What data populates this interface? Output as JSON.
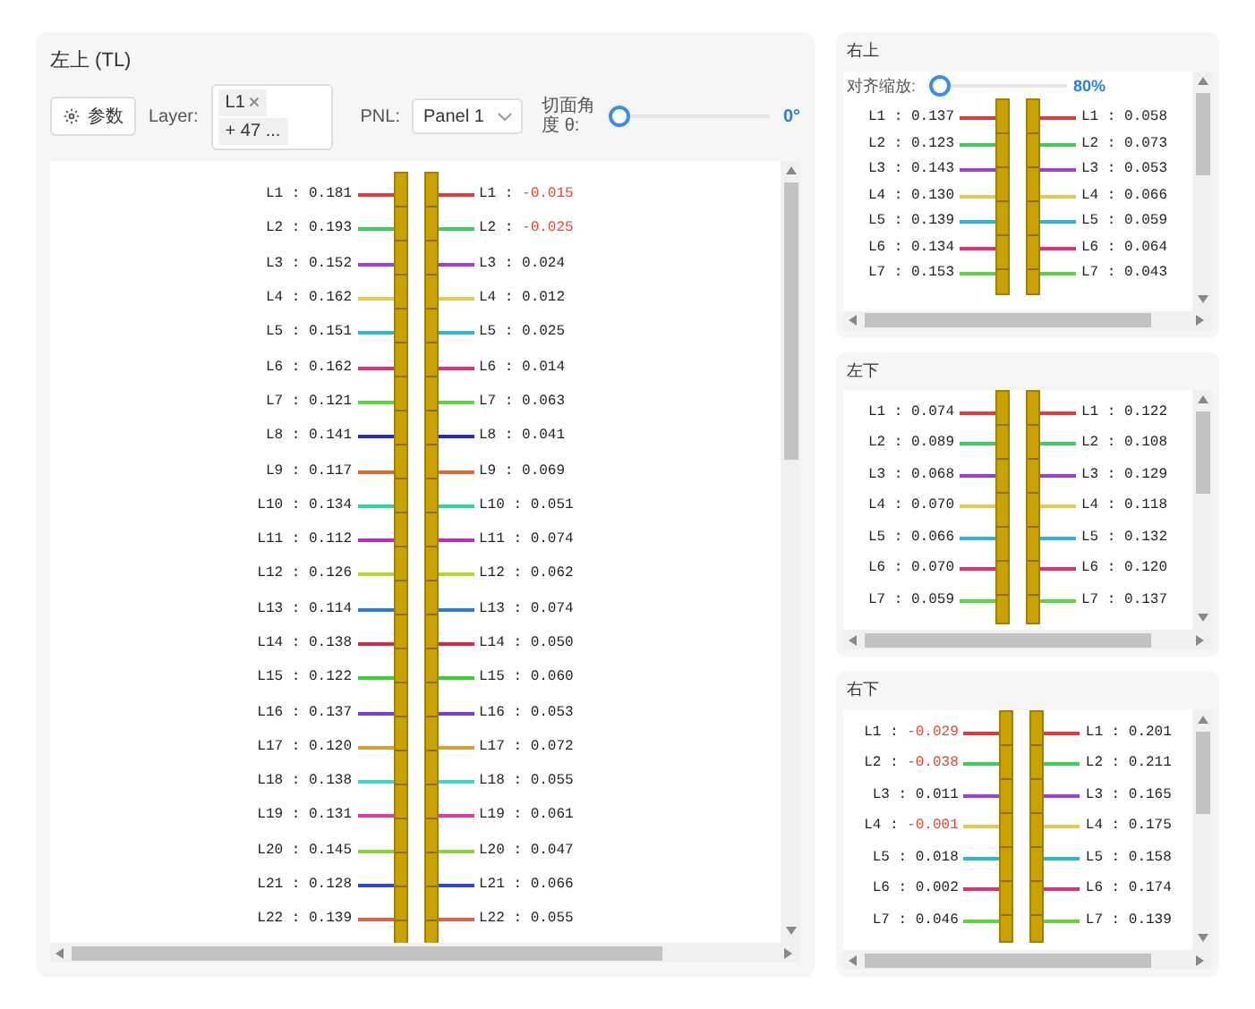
{
  "main": {
    "title": "左上 (TL)",
    "toolbar": {
      "params_button": "参数",
      "layer_label": "Layer:",
      "layer_tags": [
        "L1"
      ],
      "layer_more": "+ 47 ...",
      "pnl_label": "PNL:",
      "pnl_select": "Panel 1",
      "angle": {
        "label": "切面角度 θ:",
        "level": 0,
        "reading": "0°"
      }
    },
    "rows": [
      {
        "left_name": "L1 :",
        "left_value": "0.181",
        "left_alert": false,
        "right_name": "L1 :",
        "right_value": "-0.015",
        "right_alert": true,
        "color": "#e03c3c"
      },
      {
        "left_name": "L2 :",
        "left_value": "0.193",
        "left_alert": false,
        "right_name": "L2 :",
        "right_value": "-0.025",
        "right_alert": true,
        "color": "#3ccf5a"
      },
      {
        "left_name": "L3 :",
        "left_value": "0.152",
        "left_alert": false,
        "right_name": "L3 :",
        "right_value": "0.024",
        "right_alert": false,
        "color": "#9b3fd6"
      },
      {
        "left_name": "L4 :",
        "left_value": "0.162",
        "left_alert": false,
        "right_name": "L4 :",
        "right_value": "0.012",
        "right_alert": false,
        "color": "#e6c84a"
      },
      {
        "left_name": "L5 :",
        "left_value": "0.151",
        "left_alert": false,
        "right_name": "L5 :",
        "right_value": "0.025",
        "right_alert": false,
        "color": "#2bb5d8"
      },
      {
        "left_name": "L6 :",
        "left_value": "0.162",
        "left_alert": false,
        "right_name": "L6 :",
        "right_value": "0.014",
        "right_alert": false,
        "color": "#e0307a"
      },
      {
        "left_name": "L7 :",
        "left_value": "0.121",
        "left_alert": false,
        "right_name": "L7 :",
        "right_value": "0.063",
        "right_alert": false,
        "color": "#5bd63a"
      },
      {
        "left_name": "L8 :",
        "left_value": "0.141",
        "left_alert": false,
        "right_name": "L8 :",
        "right_value": "0.041",
        "right_alert": false,
        "color": "#2a2ab8"
      },
      {
        "left_name": "L9 :",
        "left_value": "0.117",
        "left_alert": false,
        "right_name": "L9 :",
        "right_value": "0.069",
        "right_alert": false,
        "color": "#e06a2a"
      },
      {
        "left_name": "L10 :",
        "left_value": "0.134",
        "left_alert": false,
        "right_name": "L10 :",
        "right_value": "0.051",
        "right_alert": false,
        "color": "#2ad69a"
      },
      {
        "left_name": "L11 :",
        "left_value": "0.112",
        "left_alert": false,
        "right_name": "L11 :",
        "right_value": "0.074",
        "right_alert": false,
        "color": "#c02ac8"
      },
      {
        "left_name": "L12 :",
        "left_value": "0.126",
        "left_alert": false,
        "right_name": "L12 :",
        "right_value": "0.062",
        "right_alert": false,
        "color": "#b8d62a"
      },
      {
        "left_name": "L13 :",
        "left_value": "0.114",
        "left_alert": false,
        "right_name": "L13 :",
        "right_value": "0.074",
        "right_alert": false,
        "color": "#2a7ad6"
      },
      {
        "left_name": "L14 :",
        "left_value": "0.138",
        "left_alert": false,
        "right_name": "L14 :",
        "right_value": "0.050",
        "right_alert": false,
        "color": "#d62a4a"
      },
      {
        "left_name": "L15 :",
        "left_value": "0.122",
        "left_alert": false,
        "right_name": "L15 :",
        "right_value": "0.060",
        "right_alert": false,
        "color": "#2ad62a"
      },
      {
        "left_name": "L16 :",
        "left_value": "0.137",
        "left_alert": false,
        "right_name": "L16 :",
        "right_value": "0.053",
        "right_alert": false,
        "color": "#7a3ad6"
      },
      {
        "left_name": "L17 :",
        "left_value": "0.120",
        "left_alert": false,
        "right_name": "L17 :",
        "right_value": "0.072",
        "right_alert": false,
        "color": "#e0a030"
      },
      {
        "left_name": "L18 :",
        "left_value": "0.138",
        "left_alert": false,
        "right_name": "L18 :",
        "right_value": "0.055",
        "right_alert": false,
        "color": "#3ad6d6"
      },
      {
        "left_name": "L19 :",
        "left_value": "0.131",
        "left_alert": false,
        "right_name": "L19 :",
        "right_value": "0.061",
        "right_alert": false,
        "color": "#e03ab0"
      },
      {
        "left_name": "L20 :",
        "left_value": "0.145",
        "left_alert": false,
        "right_name": "L20 :",
        "right_value": "0.047",
        "right_alert": false,
        "color": "#8ad63a"
      },
      {
        "left_name": "L21 :",
        "left_value": "0.128",
        "left_alert": false,
        "right_name": "L21 :",
        "right_value": "0.066",
        "right_alert": false,
        "color": "#2a4ad6"
      },
      {
        "left_name": "L22 :",
        "left_value": "0.139",
        "left_alert": false,
        "right_name": "L22 :",
        "right_value": "0.055",
        "right_alert": false,
        "color": "#e0604a"
      }
    ]
  },
  "side_panels": [
    {
      "title": "右上",
      "zoom": {
        "label": "对齐缩放:",
        "level": 0.05,
        "reading": "80%"
      },
      "rows": [
        {
          "left_name": "L1 :",
          "left_value": "0.137",
          "left_alert": false,
          "right_name": "L1 :",
          "right_value": "0.058",
          "right_alert": false,
          "color": "#e03c3c"
        },
        {
          "left_name": "L2 :",
          "left_value": "0.123",
          "left_alert": false,
          "right_name": "L2 :",
          "right_value": "0.073",
          "right_alert": false,
          "color": "#3ccf5a"
        },
        {
          "left_name": "L3 :",
          "left_value": "0.143",
          "left_alert": false,
          "right_name": "L3 :",
          "right_value": "0.053",
          "right_alert": false,
          "color": "#9b3fd6"
        },
        {
          "left_name": "L4 :",
          "left_value": "0.130",
          "left_alert": false,
          "right_name": "L4 :",
          "right_value": "0.066",
          "right_alert": false,
          "color": "#e6c84a"
        },
        {
          "left_name": "L5 :",
          "left_value": "0.139",
          "left_alert": false,
          "right_name": "L5 :",
          "right_value": "0.059",
          "right_alert": false,
          "color": "#2bb5d8"
        },
        {
          "left_name": "L6 :",
          "left_value": "0.134",
          "left_alert": false,
          "right_name": "L6 :",
          "right_value": "0.064",
          "right_alert": false,
          "color": "#e0307a"
        },
        {
          "left_name": "L7 :",
          "left_value": "0.153",
          "left_alert": false,
          "right_name": "L7 :",
          "right_value": "0.043",
          "right_alert": false,
          "color": "#5bd63a"
        }
      ]
    },
    {
      "title": "左下",
      "rows": [
        {
          "left_name": "L1 :",
          "left_value": "0.074",
          "left_alert": false,
          "right_name": "L1 :",
          "right_value": "0.122",
          "right_alert": false,
          "color": "#e03c3c"
        },
        {
          "left_name": "L2 :",
          "left_value": "0.089",
          "left_alert": false,
          "right_name": "L2 :",
          "right_value": "0.108",
          "right_alert": false,
          "color": "#3ccf5a"
        },
        {
          "left_name": "L3 :",
          "left_value": "0.068",
          "left_alert": false,
          "right_name": "L3 :",
          "right_value": "0.129",
          "right_alert": false,
          "color": "#9b3fd6"
        },
        {
          "left_name": "L4 :",
          "left_value": "0.070",
          "left_alert": false,
          "right_name": "L4 :",
          "right_value": "0.118",
          "right_alert": false,
          "color": "#e6c84a"
        },
        {
          "left_name": "L5 :",
          "left_value": "0.066",
          "left_alert": false,
          "right_name": "L5 :",
          "right_value": "0.132",
          "right_alert": false,
          "color": "#2bb5d8"
        },
        {
          "left_name": "L6 :",
          "left_value": "0.070",
          "left_alert": false,
          "right_name": "L6 :",
          "right_value": "0.120",
          "right_alert": false,
          "color": "#e0307a"
        },
        {
          "left_name": "L7 :",
          "left_value": "0.059",
          "left_alert": false,
          "right_name": "L7 :",
          "right_value": "0.137",
          "right_alert": false,
          "color": "#5bd63a"
        }
      ]
    },
    {
      "title": "右下",
      "rows": [
        {
          "left_name": "L1 :",
          "left_value": "-0.029",
          "left_alert": true,
          "right_name": "L1 :",
          "right_value": "0.201",
          "right_alert": false,
          "color": "#e03c3c"
        },
        {
          "left_name": "L2 :",
          "left_value": "-0.038",
          "left_alert": true,
          "right_name": "L2 :",
          "right_value": "0.211",
          "right_alert": false,
          "color": "#3ccf5a"
        },
        {
          "left_name": "L3 :",
          "left_value": "0.011",
          "left_alert": false,
          "right_name": "L3 :",
          "right_value": "0.165",
          "right_alert": false,
          "color": "#9b3fd6"
        },
        {
          "left_name": "L4 :",
          "left_value": "-0.001",
          "left_alert": true,
          "right_name": "L4 :",
          "right_value": "0.175",
          "right_alert": false,
          "color": "#e6c84a"
        },
        {
          "left_name": "L5 :",
          "left_value": "0.018",
          "left_alert": false,
          "right_name": "L5 :",
          "right_value": "0.158",
          "right_alert": false,
          "color": "#2bb5d8"
        },
        {
          "left_name": "L6 :",
          "left_value": "0.002",
          "left_alert": false,
          "right_name": "L6 :",
          "right_value": "0.174",
          "right_alert": false,
          "color": "#e0307a"
        },
        {
          "left_name": "L7 :",
          "left_value": "0.046",
          "left_alert": false,
          "right_name": "L7 :",
          "right_value": "0.139",
          "right_alert": false,
          "color": "#5bd63a"
        }
      ]
    }
  ]
}
